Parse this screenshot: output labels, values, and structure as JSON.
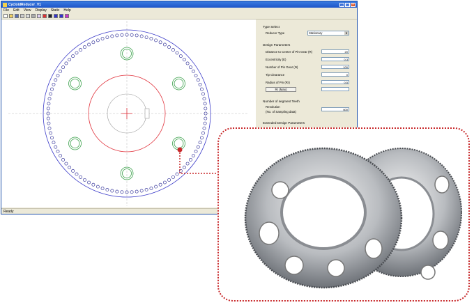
{
  "window": {
    "title": "CycloidReducer_V1",
    "menu": [
      "File",
      "Edit",
      "View",
      "Display",
      "Static",
      "Help"
    ]
  },
  "panel": {
    "type_select": {
      "title": "Type Select",
      "reducer_type_label": "Reducer Type",
      "reducer_type_value": "Stationary"
    },
    "design_params": {
      "title": "Design Parameters",
      "rows": [
        {
          "label": "Distance to Center of Pin Gear (R)",
          "value": "20"
        },
        {
          "label": "Eccentricity (E)",
          "value": "0.3"
        },
        {
          "label": "Number of Pin Gear (N)",
          "value": "100"
        },
        {
          "label": "Tip Clearance",
          "value": "0"
        },
        {
          "label": "Radius of Pin (Rr)",
          "value": "0.5"
        }
      ],
      "button": "Rr (Max)"
    },
    "segment": {
      "title": "Number of segment Teeth",
      "resolution_label": "Resolution",
      "sampling_label": "(No. of Sampling data)",
      "resolution_value": "600"
    },
    "extended_title": "Extended Design Parameters"
  },
  "status_text": "Ready",
  "colors": {
    "accent": "#c8282a",
    "pin": "#3b3b9e",
    "hole": "#3aa04a",
    "profile": "#e0303a"
  }
}
